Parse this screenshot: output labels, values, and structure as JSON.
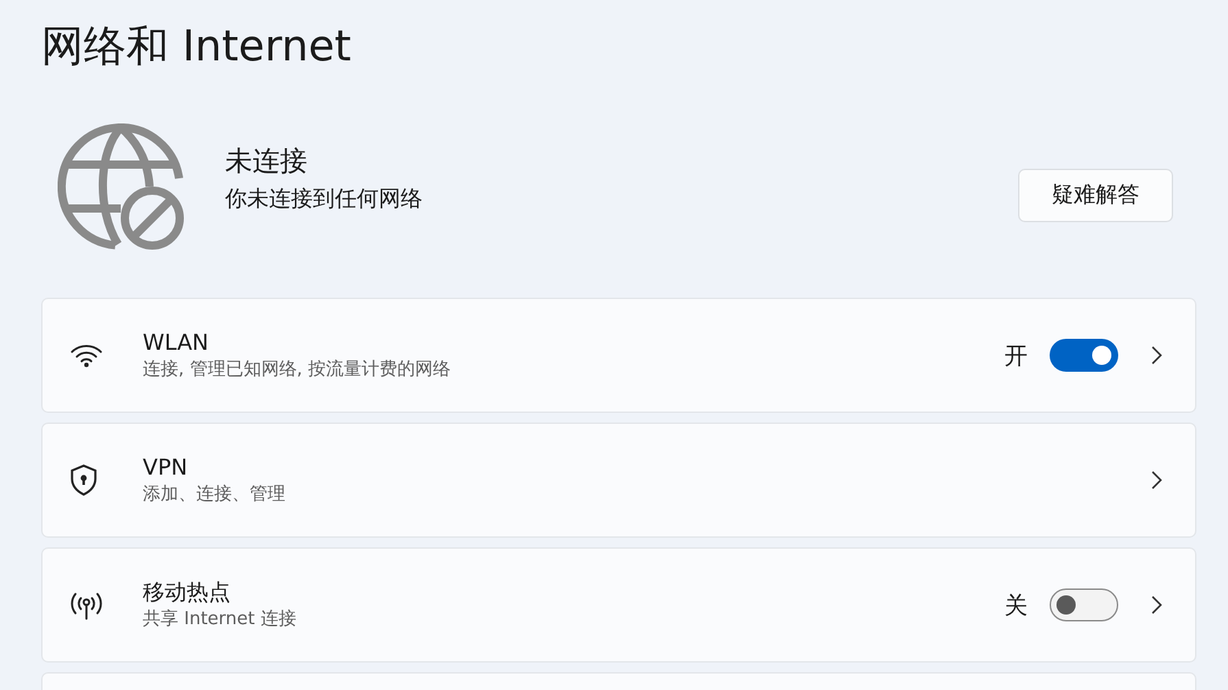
{
  "page_title": "网络和 Internet",
  "status": {
    "title": "未连接",
    "subtitle": "你未连接到任何网络",
    "button": "疑难解答"
  },
  "items": [
    {
      "kind": "toggle",
      "title": "WLAN",
      "subtitle": "连接, 管理已知网络, 按流量计费的网络",
      "state_label": "开",
      "on": true
    },
    {
      "kind": "link",
      "title": "VPN",
      "subtitle": "添加、连接、管理"
    },
    {
      "kind": "toggle",
      "title": "移动热点",
      "subtitle": "共享 Internet 连接",
      "state_label": "关",
      "on": false
    }
  ]
}
